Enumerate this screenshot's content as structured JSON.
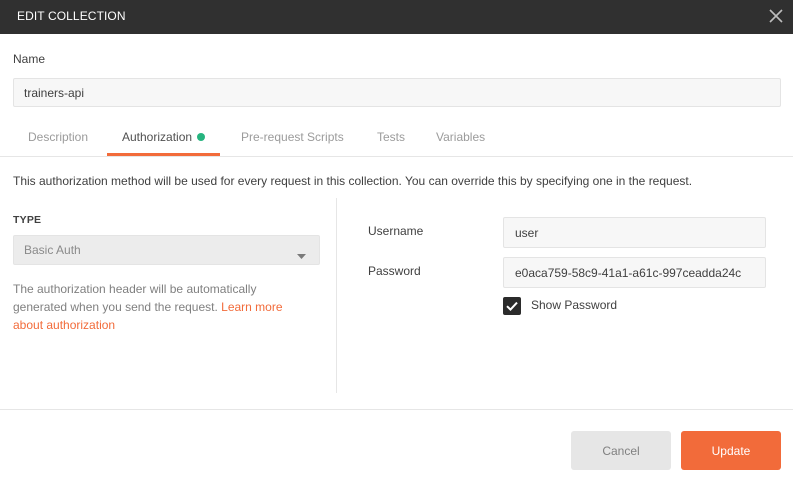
{
  "dialog": {
    "title": "EDIT COLLECTION"
  },
  "name": {
    "label": "Name",
    "value": "trainers-api"
  },
  "tabs": [
    {
      "label": "Description",
      "active": false
    },
    {
      "label": "Authorization",
      "active": true,
      "indicator_color": "#26b47f"
    },
    {
      "label": "Pre-request Scripts",
      "active": false
    },
    {
      "label": "Tests",
      "active": false
    },
    {
      "label": "Variables",
      "active": false
    }
  ],
  "auth": {
    "info": "This authorization method will be used for every request in this collection. You can override this by specifying one in the request.",
    "type_label": "TYPE",
    "type_value": "Basic Auth",
    "help_text": "The authorization header will be automatically generated when you send the request. ",
    "help_link": "Learn more about authorization",
    "username_label": "Username",
    "username_value": "user",
    "password_label": "Password",
    "password_value": "e0aca759-58c9-41a1-a61c-997ceadda24c",
    "show_password_label": "Show Password",
    "show_password_checked": true
  },
  "footer": {
    "cancel_label": "Cancel",
    "update_label": "Update"
  },
  "colors": {
    "accent": "#f26b3a",
    "titlebar": "#303030",
    "status_dot": "#26b47f"
  },
  "icons": {
    "close": "close-icon",
    "dropdown": "chevron-down-icon",
    "checkbox": "checkmark-icon"
  }
}
